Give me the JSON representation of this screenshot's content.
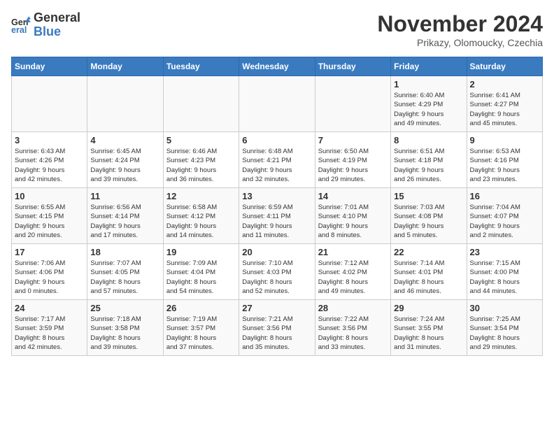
{
  "header": {
    "logo_general": "General",
    "logo_blue": "Blue",
    "title": "November 2024",
    "subtitle": "Prikazy, Olomoucky, Czechia"
  },
  "weekdays": [
    "Sunday",
    "Monday",
    "Tuesday",
    "Wednesday",
    "Thursday",
    "Friday",
    "Saturday"
  ],
  "weeks": [
    [
      {
        "day": "",
        "info": ""
      },
      {
        "day": "",
        "info": ""
      },
      {
        "day": "",
        "info": ""
      },
      {
        "day": "",
        "info": ""
      },
      {
        "day": "",
        "info": ""
      },
      {
        "day": "1",
        "info": "Sunrise: 6:40 AM\nSunset: 4:29 PM\nDaylight: 9 hours\nand 49 minutes."
      },
      {
        "day": "2",
        "info": "Sunrise: 6:41 AM\nSunset: 4:27 PM\nDaylight: 9 hours\nand 45 minutes."
      }
    ],
    [
      {
        "day": "3",
        "info": "Sunrise: 6:43 AM\nSunset: 4:26 PM\nDaylight: 9 hours\nand 42 minutes."
      },
      {
        "day": "4",
        "info": "Sunrise: 6:45 AM\nSunset: 4:24 PM\nDaylight: 9 hours\nand 39 minutes."
      },
      {
        "day": "5",
        "info": "Sunrise: 6:46 AM\nSunset: 4:23 PM\nDaylight: 9 hours\nand 36 minutes."
      },
      {
        "day": "6",
        "info": "Sunrise: 6:48 AM\nSunset: 4:21 PM\nDaylight: 9 hours\nand 32 minutes."
      },
      {
        "day": "7",
        "info": "Sunrise: 6:50 AM\nSunset: 4:19 PM\nDaylight: 9 hours\nand 29 minutes."
      },
      {
        "day": "8",
        "info": "Sunrise: 6:51 AM\nSunset: 4:18 PM\nDaylight: 9 hours\nand 26 minutes."
      },
      {
        "day": "9",
        "info": "Sunrise: 6:53 AM\nSunset: 4:16 PM\nDaylight: 9 hours\nand 23 minutes."
      }
    ],
    [
      {
        "day": "10",
        "info": "Sunrise: 6:55 AM\nSunset: 4:15 PM\nDaylight: 9 hours\nand 20 minutes."
      },
      {
        "day": "11",
        "info": "Sunrise: 6:56 AM\nSunset: 4:14 PM\nDaylight: 9 hours\nand 17 minutes."
      },
      {
        "day": "12",
        "info": "Sunrise: 6:58 AM\nSunset: 4:12 PM\nDaylight: 9 hours\nand 14 minutes."
      },
      {
        "day": "13",
        "info": "Sunrise: 6:59 AM\nSunset: 4:11 PM\nDaylight: 9 hours\nand 11 minutes."
      },
      {
        "day": "14",
        "info": "Sunrise: 7:01 AM\nSunset: 4:10 PM\nDaylight: 9 hours\nand 8 minutes."
      },
      {
        "day": "15",
        "info": "Sunrise: 7:03 AM\nSunset: 4:08 PM\nDaylight: 9 hours\nand 5 minutes."
      },
      {
        "day": "16",
        "info": "Sunrise: 7:04 AM\nSunset: 4:07 PM\nDaylight: 9 hours\nand 2 minutes."
      }
    ],
    [
      {
        "day": "17",
        "info": "Sunrise: 7:06 AM\nSunset: 4:06 PM\nDaylight: 9 hours\nand 0 minutes."
      },
      {
        "day": "18",
        "info": "Sunrise: 7:07 AM\nSunset: 4:05 PM\nDaylight: 8 hours\nand 57 minutes."
      },
      {
        "day": "19",
        "info": "Sunrise: 7:09 AM\nSunset: 4:04 PM\nDaylight: 8 hours\nand 54 minutes."
      },
      {
        "day": "20",
        "info": "Sunrise: 7:10 AM\nSunset: 4:03 PM\nDaylight: 8 hours\nand 52 minutes."
      },
      {
        "day": "21",
        "info": "Sunrise: 7:12 AM\nSunset: 4:02 PM\nDaylight: 8 hours\nand 49 minutes."
      },
      {
        "day": "22",
        "info": "Sunrise: 7:14 AM\nSunset: 4:01 PM\nDaylight: 8 hours\nand 46 minutes."
      },
      {
        "day": "23",
        "info": "Sunrise: 7:15 AM\nSunset: 4:00 PM\nDaylight: 8 hours\nand 44 minutes."
      }
    ],
    [
      {
        "day": "24",
        "info": "Sunrise: 7:17 AM\nSunset: 3:59 PM\nDaylight: 8 hours\nand 42 minutes."
      },
      {
        "day": "25",
        "info": "Sunrise: 7:18 AM\nSunset: 3:58 PM\nDaylight: 8 hours\nand 39 minutes."
      },
      {
        "day": "26",
        "info": "Sunrise: 7:19 AM\nSunset: 3:57 PM\nDaylight: 8 hours\nand 37 minutes."
      },
      {
        "day": "27",
        "info": "Sunrise: 7:21 AM\nSunset: 3:56 PM\nDaylight: 8 hours\nand 35 minutes."
      },
      {
        "day": "28",
        "info": "Sunrise: 7:22 AM\nSunset: 3:56 PM\nDaylight: 8 hours\nand 33 minutes."
      },
      {
        "day": "29",
        "info": "Sunrise: 7:24 AM\nSunset: 3:55 PM\nDaylight: 8 hours\nand 31 minutes."
      },
      {
        "day": "30",
        "info": "Sunrise: 7:25 AM\nSunset: 3:54 PM\nDaylight: 8 hours\nand 29 minutes."
      }
    ]
  ]
}
